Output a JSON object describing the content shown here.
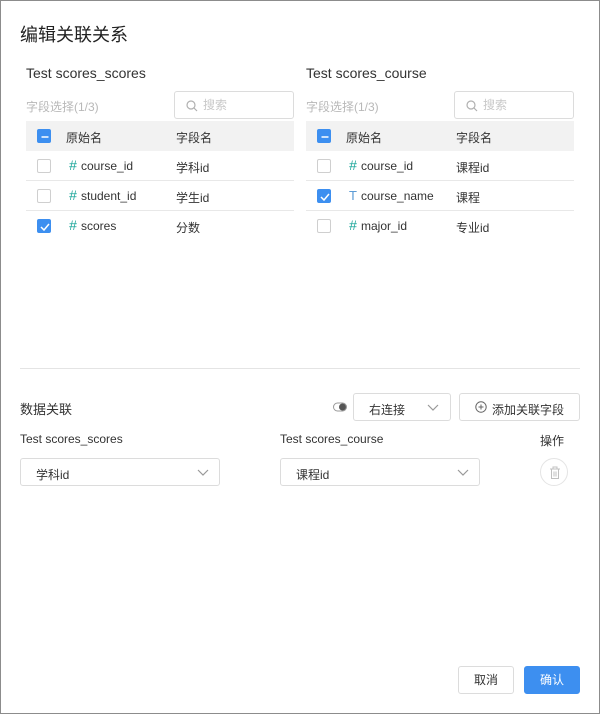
{
  "dialog": {
    "title": "编辑关联关系"
  },
  "left_panel": {
    "title": "Test scores_scores",
    "selection_count": "字段选择(1/3)",
    "search_placeholder": "搜索",
    "header": {
      "original_name": "原始名",
      "field_name": "字段名"
    },
    "select_all_state": "partial",
    "rows": [
      {
        "type_icon": "number-icon",
        "name": "course_id",
        "alias": "学科id",
        "checked": false
      },
      {
        "type_icon": "number-icon",
        "name": "student_id",
        "alias": "学生id",
        "checked": false
      },
      {
        "type_icon": "number-icon",
        "name": "scores",
        "alias": "分数",
        "checked": true
      }
    ]
  },
  "right_panel": {
    "title": "Test scores_course",
    "selection_count": "字段选择(1/3)",
    "search_placeholder": "搜索",
    "header": {
      "original_name": "原始名",
      "field_name": "字段名"
    },
    "select_all_state": "partial",
    "rows": [
      {
        "type_icon": "number-icon",
        "name": "course_id",
        "alias": "课程id",
        "checked": false
      },
      {
        "type_icon": "text-icon",
        "name": "course_name",
        "alias": "课程",
        "checked": true
      },
      {
        "type_icon": "number-icon",
        "name": "major_id",
        "alias": "专业id",
        "checked": false
      }
    ]
  },
  "relation": {
    "section_title": "数据关联",
    "join_type": "右连接",
    "add_button_label": "添加关联字段",
    "left_table_header": "Test scores_scores",
    "right_table_header": "Test scores_course",
    "action_header": "操作",
    "mappings": [
      {
        "left_field": "学科id",
        "right_field": "课程id"
      }
    ]
  },
  "footer": {
    "cancel_label": "取消",
    "confirm_label": "确认"
  },
  "colors": {
    "accent": "#3d8ff0",
    "number_icon": "#1aa69a",
    "text_icon": "#5b9bd5"
  }
}
